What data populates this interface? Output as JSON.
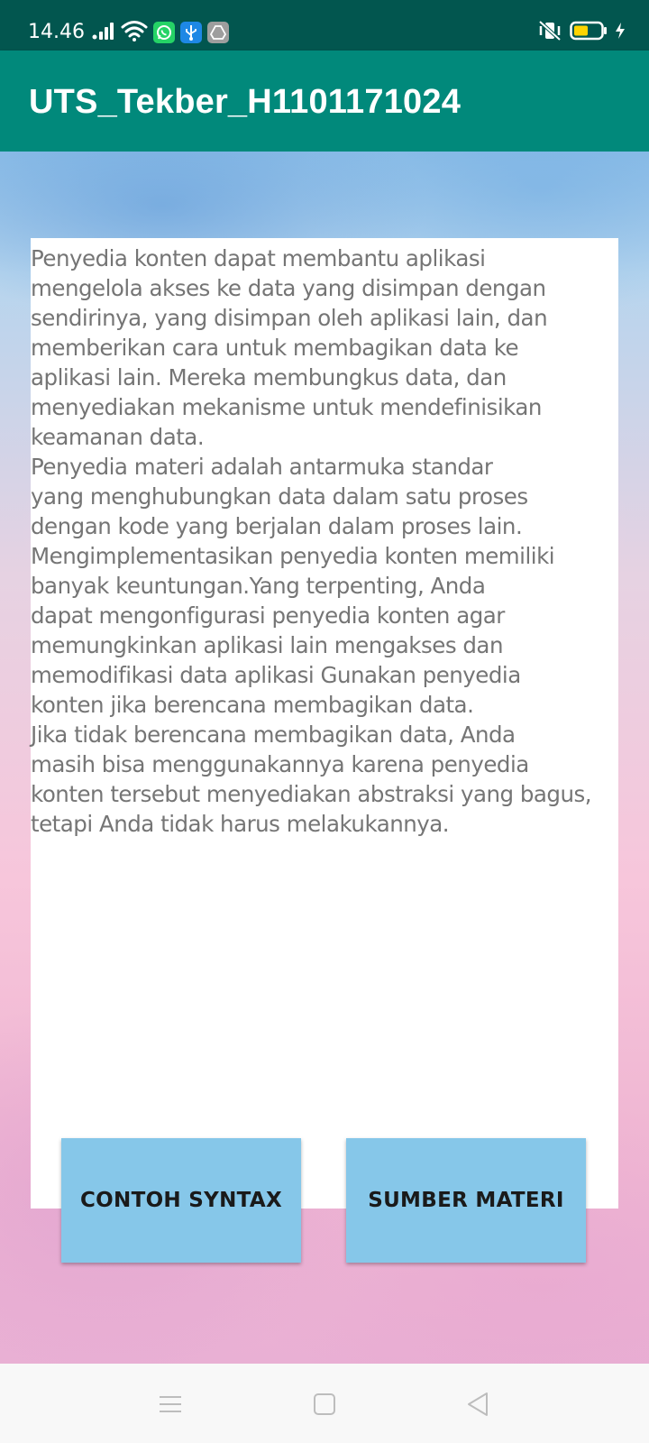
{
  "status_bar": {
    "time": "14.46",
    "icons_left": [
      "signal-icon",
      "wifi-icon",
      "whatsapp-icon",
      "usb-icon",
      "drive-icon"
    ],
    "icons_right": [
      "vibrate-icon",
      "battery-icon",
      "charging-icon"
    ]
  },
  "app_bar": {
    "title": "UTS_Tekber_H1101171024"
  },
  "content": {
    "body": "Penyedia konten dapat membantu aplikasi\nmengelola akses ke data yang disimpan dengan\nsendirinya, yang disimpan oleh aplikasi lain, dan\nmemberikan cara untuk membagikan data ke\naplikasi lain. Mereka membungkus data, dan\nmenyediakan mekanisme untuk mendefinisikan\nkeamanan data.\n Penyedia materi adalah antarmuka standar\nyang menghubungkan data dalam satu proses\ndengan kode yang berjalan dalam proses lain.\nMengimplementasikan penyedia konten memiliki\nbanyak keuntungan.Yang terpenting, Anda\ndapat mengonfigurasi penyedia konten agar\nmemungkinkan aplikasi lain mengakses dan\nmemodifikasi data aplikasi Gunakan penyedia\nkonten jika berencana membagikan data.\n Jika tidak berencana membagikan data, Anda\nmasih bisa menggunakannya karena penyedia\nkonten tersebut menyediakan abstraksi yang bagus,\ntetapi Anda tidak harus melakukannya."
  },
  "buttons": {
    "left_label": "CONTOH SYNTAX",
    "right_label": "SUMBER MATERI"
  },
  "nav_bar": {
    "icons": [
      "menu-icon",
      "home-square-icon",
      "back-triangle-icon"
    ]
  },
  "colors": {
    "status_bar": "#02564f",
    "app_bar": "#01897b",
    "button": "#86c7e9",
    "body_text": "#757575"
  }
}
